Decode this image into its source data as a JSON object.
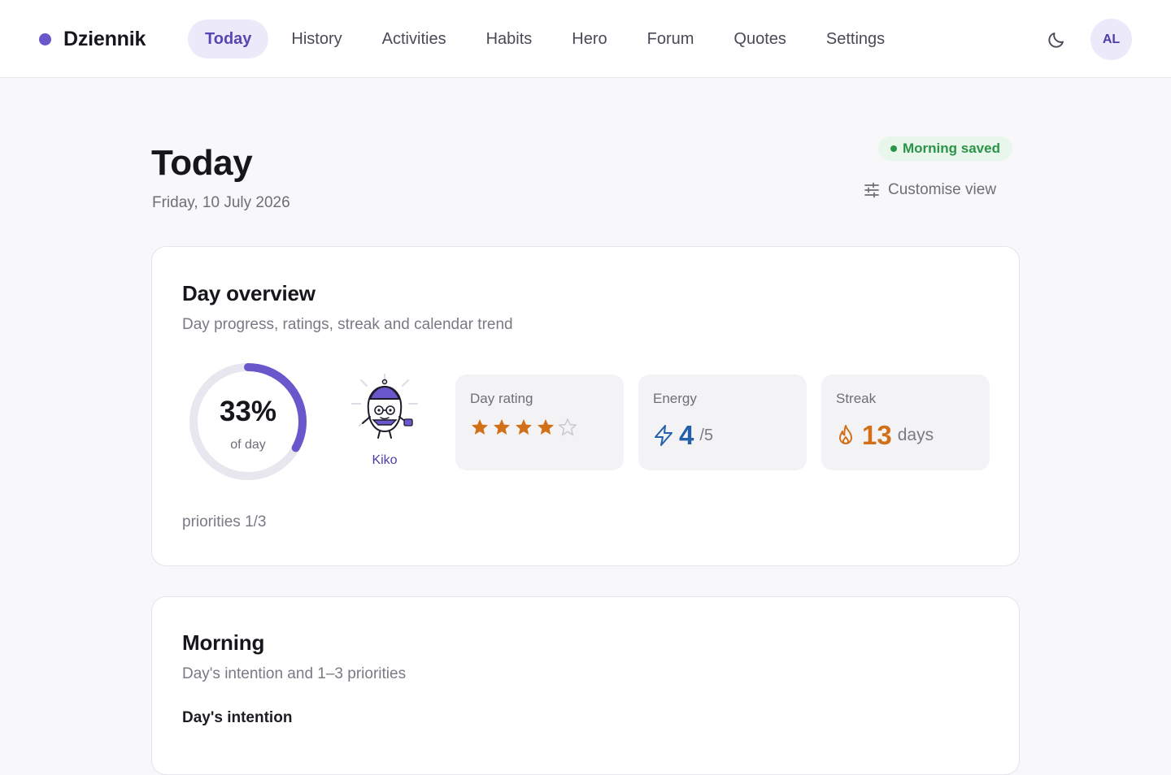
{
  "app": {
    "name": "Dziennik",
    "accent": "#6a57cc"
  },
  "nav": {
    "items": [
      {
        "label": "Today",
        "active": true
      },
      {
        "label": "History"
      },
      {
        "label": "Activities"
      },
      {
        "label": "Habits"
      },
      {
        "label": "Hero"
      },
      {
        "label": "Forum"
      },
      {
        "label": "Quotes"
      },
      {
        "label": "Settings"
      }
    ]
  },
  "header": {
    "theme_icon": "moon-icon",
    "avatar_initials": "AL"
  },
  "page": {
    "title": "Today",
    "date": "Friday, 10 July 2026",
    "status_badge": "Morning saved",
    "customise_label": "Customise view",
    "status_color": "#2a9448"
  },
  "overview": {
    "title": "Day overview",
    "subtitle": "Day progress, ratings, streak and calendar trend",
    "progress": {
      "value_text": "33%",
      "percent": 33,
      "label": "of day"
    },
    "mascot": {
      "name": "Kiko"
    },
    "rating": {
      "label": "Day rating",
      "value": 4,
      "max": 5,
      "color": "#d2701a"
    },
    "energy": {
      "label": "Energy",
      "value": "4",
      "unit": "/5",
      "color": "#2360a8"
    },
    "streak": {
      "label": "Streak",
      "value": "13",
      "unit": "days",
      "color": "#d2701a"
    },
    "priorities": "priorities 1/3"
  },
  "morning": {
    "title": "Morning",
    "subtitle": "Day's intention and 1–3 priorities",
    "intention_label": "Day's intention"
  }
}
